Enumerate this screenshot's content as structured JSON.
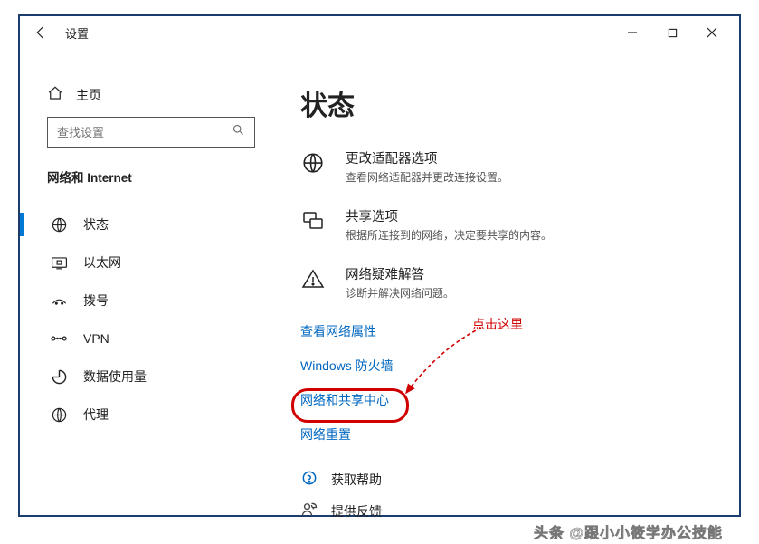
{
  "window": {
    "title": "设置"
  },
  "sidebar": {
    "home": "主页",
    "search_placeholder": "查找设置",
    "section": "网络和 Internet",
    "items": [
      {
        "label": "状态"
      },
      {
        "label": "以太网"
      },
      {
        "label": "拨号"
      },
      {
        "label": "VPN"
      },
      {
        "label": "数据使用量"
      },
      {
        "label": "代理"
      }
    ]
  },
  "main": {
    "page_title": "状态",
    "options": [
      {
        "title": "更改适配器选项",
        "desc": "查看网络适配器并更改连接设置。"
      },
      {
        "title": "共享选项",
        "desc": "根据所连接到的网络，决定要共享的内容。"
      },
      {
        "title": "网络疑难解答",
        "desc": "诊断并解决网络问题。"
      }
    ],
    "links": [
      "查看网络属性",
      "Windows 防火墙",
      "网络和共享中心",
      "网络重置"
    ],
    "footer": [
      "获取帮助",
      "提供反馈"
    ]
  },
  "annotation": {
    "label": "点击这里"
  },
  "watermark": "头条 @跟小小筱学办公技能"
}
